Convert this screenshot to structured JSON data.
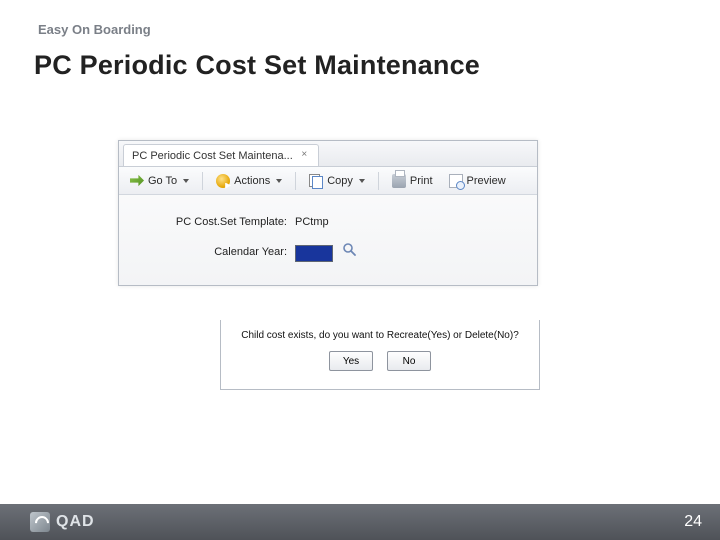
{
  "header": {
    "eyebrow": "Easy On Boarding",
    "title": "PC Periodic Cost Set Maintenance"
  },
  "app": {
    "tab_title": "PC Periodic Cost Set Maintena...",
    "toolbar": {
      "goto": "Go To",
      "actions": "Actions",
      "copy": "Copy",
      "print": "Print",
      "preview": "Preview"
    },
    "form": {
      "template_label": "PC Cost.Set Template:",
      "template_value": "PCtmp",
      "year_label": "Calendar Year:",
      "year_value": ""
    }
  },
  "dialog": {
    "message": "Child cost exists, do you want to Recreate(Yes) or Delete(No)?",
    "yes": "Yes",
    "no": "No"
  },
  "footer": {
    "brand": "QAD",
    "page": "24"
  }
}
